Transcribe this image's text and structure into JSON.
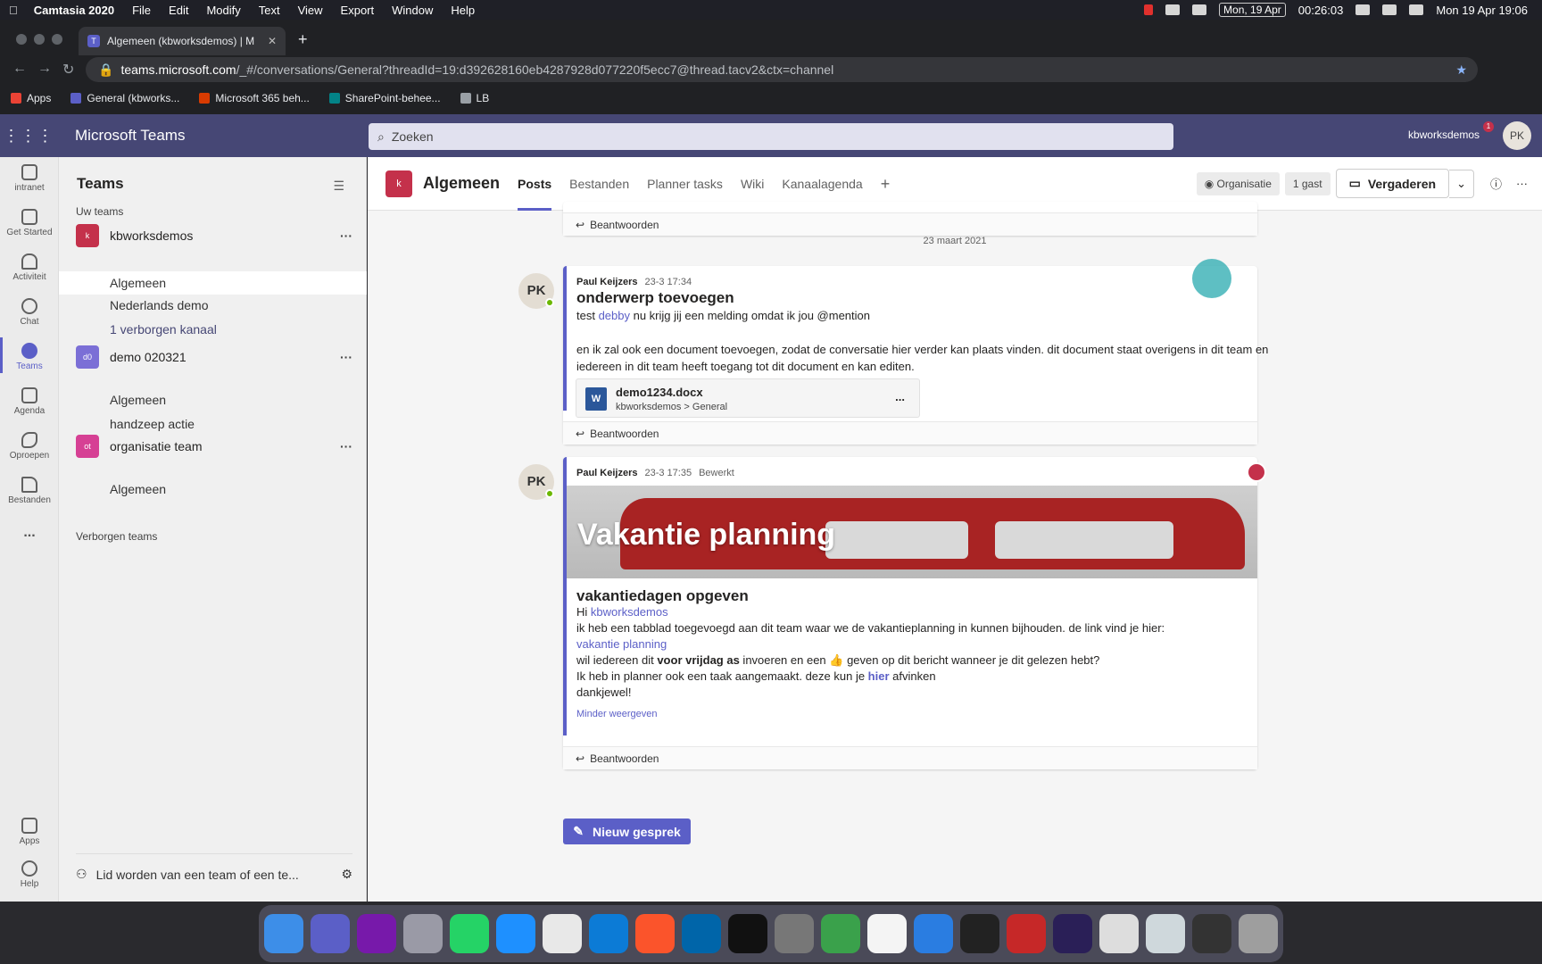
{
  "menubar": {
    "app": "Camtasia 2020",
    "items": [
      "File",
      "Edit",
      "Modify",
      "Text",
      "View",
      "Export",
      "Window",
      "Help"
    ],
    "date_box": "Mon, 19 Apr",
    "timer": "00:26:03",
    "clock": "Mon 19 Apr  19:06"
  },
  "browser": {
    "tab_title": "Algemeen (kbworksdemos) | M",
    "url_host": "teams.microsoft.com",
    "url_path": "/_#/conversations/General?threadId=19:d392628160eb4287928d077220f5ecc7@thread.tacv2&ctx=channel",
    "bookmarks": [
      "Apps",
      "General (kbworks...",
      "Microsoft 365 beh...",
      "SharePoint-behee...",
      "LB"
    ]
  },
  "teams": {
    "app_title": "Microsoft Teams",
    "search_placeholder": "Zoeken",
    "account": "kbworksdemos",
    "notification_count": "1",
    "avatar": "PK"
  },
  "rail": {
    "items": [
      {
        "label": "intranet",
        "icon": "intranet-icon"
      },
      {
        "label": "Get Started",
        "icon": "get-started-icon"
      },
      {
        "label": "Activiteit",
        "icon": "bell-icon"
      },
      {
        "label": "Chat",
        "icon": "chat-icon"
      },
      {
        "label": "Teams",
        "icon": "teams-icon"
      },
      {
        "label": "Agenda",
        "icon": "calendar-icon"
      },
      {
        "label": "Oproepen",
        "icon": "phone-icon"
      },
      {
        "label": "Bestanden",
        "icon": "file-icon"
      },
      {
        "label": "Apps",
        "icon": "apps-icon"
      },
      {
        "label": "Help",
        "icon": "help-icon"
      }
    ],
    "more": "..."
  },
  "teamspane": {
    "title": "Teams",
    "section": "Uw teams",
    "hidden_section": "Verborgen teams",
    "teams": [
      {
        "name": "kbworksdemos",
        "initials": "k",
        "color": "#c4314b",
        "channels": [
          "Algemeen",
          "Nederlands demo",
          "1 verborgen kanaal"
        ]
      },
      {
        "name": "demo 020321",
        "initials": "d0",
        "color": "#7b6fd6",
        "channels": [
          "Algemeen",
          "handzeep actie"
        ]
      },
      {
        "name": "organisatie team",
        "initials": "ot",
        "color": "#d64094",
        "channels": [
          "Algemeen"
        ]
      }
    ],
    "join": "Lid worden van een team of een te..."
  },
  "channel": {
    "icon": "k",
    "name": "Algemeen",
    "tabs": [
      "Posts",
      "Bestanden",
      "Planner tasks",
      "Wiki",
      "Kanaalagenda"
    ],
    "org_pill": "Organisatie",
    "guest_pill": "1 gast",
    "meet_button": "Vergaderen"
  },
  "conversation": {
    "reply_label": "Beantwoorden",
    "date_separator": "23 maart 2021",
    "post1": {
      "author": "Paul Keijzers",
      "time": "23-3 17:34",
      "avatar": "PK",
      "subject": "onderwerp toevoegen",
      "line1_pre": "test ",
      "line1_mention": "debby",
      "line1_post": " nu krijg jij een melding omdat ik jou @mention",
      "line2": "en ik zal ook een document toevoegen, zodat de conversatie hier verder kan plaats vinden. dit document staat overigens in dit team en",
      "line3": "iedereen in dit team heeft toegang tot dit document en kan editen.",
      "doc_name": "demo1234.docx",
      "doc_path_team": "kbworksdemos",
      "doc_path_sep": ">",
      "doc_path_channel": "General",
      "doc_more": "..."
    },
    "post2": {
      "author": "Paul Keijzers",
      "time": "23-3 17:35",
      "edited": "Bewerkt",
      "avatar": "PK",
      "banner_title": "Vakantie planning",
      "subject": "vakantiedagen opgeven",
      "hi": "Hi ",
      "mention": "kbworksdemos",
      "line1": "ik heb een tabblad toegevoegd aan dit team waar we de vakantieplanning in kunnen bijhouden. de link vind je hier:",
      "link": "vakantie planning",
      "line2_pre": "wil iedereen dit ",
      "line2_bold": "voor vrijdag as",
      "line2_post": " invoeren en een 👍 geven op dit bericht wanneer je dit gelezen hebt?",
      "line3_pre": "Ik heb in planner ook een taak aangemaakt. deze kun je ",
      "line3_link": "hier",
      "line3_post": " afvinken",
      "line4": "dankjewel!",
      "less": "Minder weergeven"
    },
    "new_conversation": "Nieuw gesprek"
  }
}
